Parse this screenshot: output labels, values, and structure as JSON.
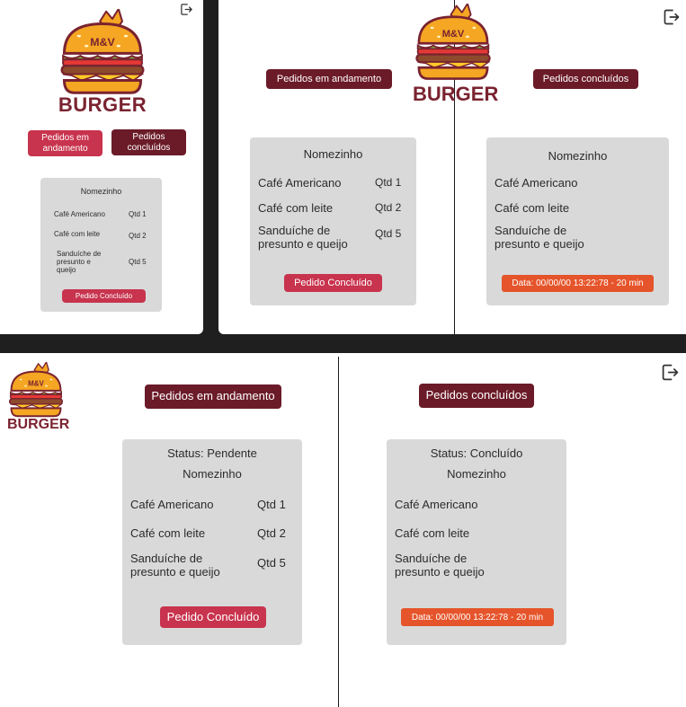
{
  "brand": {
    "logo_text": "M&V",
    "name": "BURGER"
  },
  "labels": {
    "in_progress": "Pedidos em andamento",
    "completed": "Pedidos concluídos",
    "complete_btn": "Pedido Concluído",
    "qty1": "Qtd 1",
    "qty2": "Qtd 2",
    "qty5": "Qtd 5"
  },
  "mobile": {
    "btn_in_progress": "Pedidos em andamento",
    "btn_completed": "Pedidos concluídos"
  },
  "order": {
    "customer": "Nomezinho",
    "items": [
      "Café Americano",
      "Café com leite",
      "Sanduíche de presunto e queijo"
    ]
  },
  "status": {
    "pending": "Status: Pendente",
    "done": "Status: Concluído"
  },
  "date_text": "Data: 00/00/00 13:22:78 - 20 min",
  "colors": {
    "dark_button": "#6b1b28",
    "red_button": "#c8334d",
    "date_badge": "#e5542a",
    "card": "#d9d9d9"
  }
}
